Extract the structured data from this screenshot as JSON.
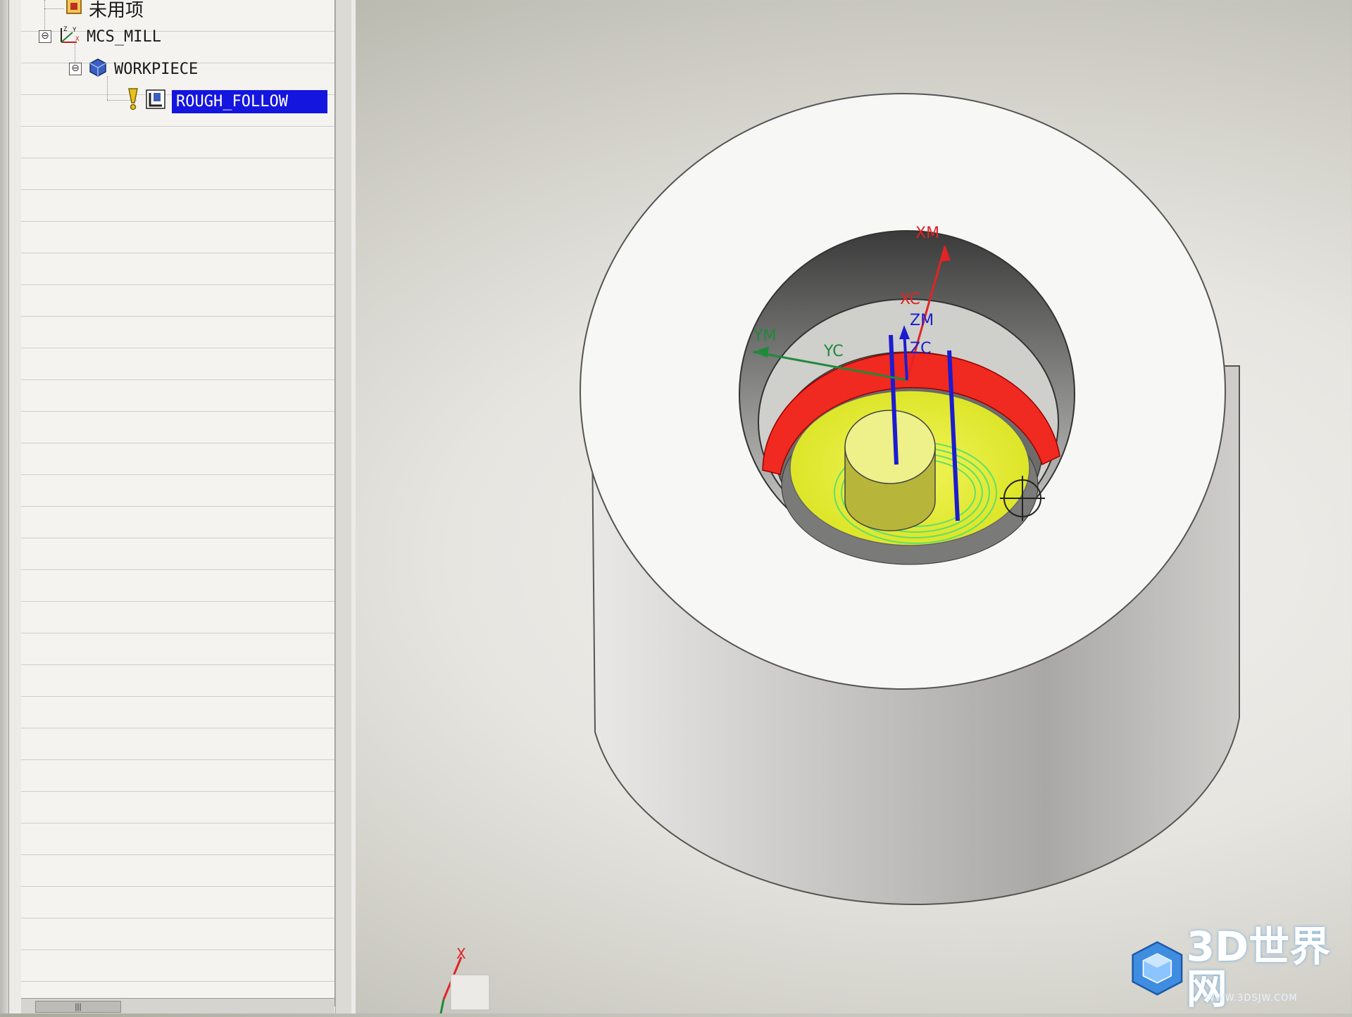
{
  "navigator": {
    "items": [
      {
        "label": "未用项",
        "icon": "unused-items-icon"
      },
      {
        "label": "MCS_MILL",
        "icon": "mcs-axes-icon",
        "expander": "⊖"
      },
      {
        "label": "WORKPIECE",
        "icon": "workpiece-cube-icon",
        "expander": "⊖"
      },
      {
        "label": "ROUGH_FOLLOW",
        "icon": "rough-follow-operation-icon",
        "status_icon": "pending-exclamation-icon",
        "selected": true
      }
    ],
    "scroll_thumb": "|||"
  },
  "viewport": {
    "axis_labels": {
      "xm": "XM",
      "xc": "XC",
      "zm": "ZM",
      "zc": "ZC",
      "ym": "YM",
      "yc": "YC",
      "triad_x": "X"
    },
    "colors": {
      "red_axis": "#e12424",
      "blue_axis": "#1c1ccf",
      "green_axis": "#1e8a3a",
      "toolpath_ring": "#f02a20",
      "floor": "#e6ee2a",
      "toolpath_green": "#5ee06a"
    }
  },
  "watermark": {
    "text": "3D世界网",
    "url": "WWW.3DSJW.COM"
  }
}
